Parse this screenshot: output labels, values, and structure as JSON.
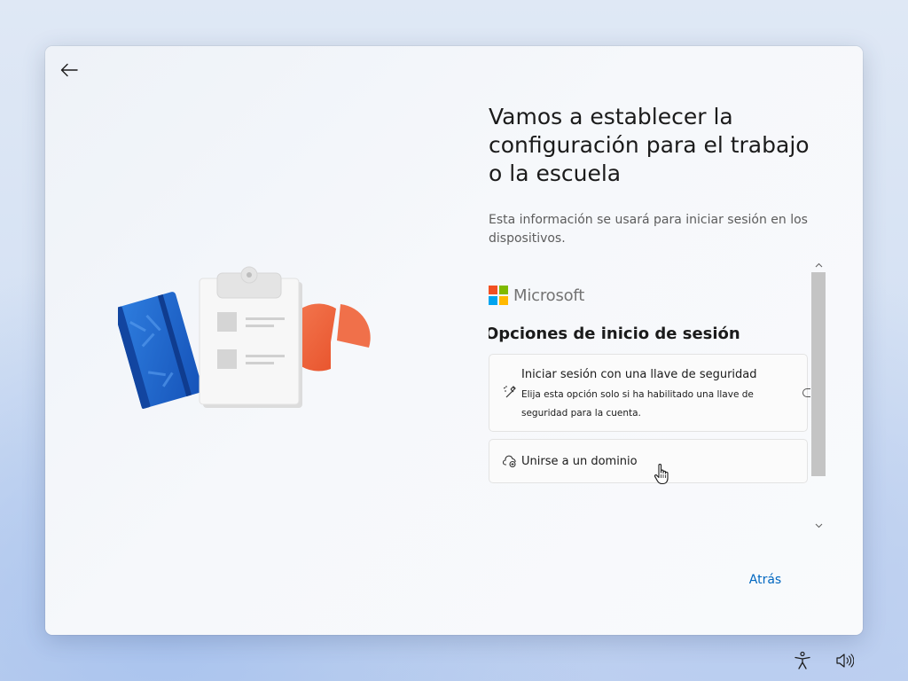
{
  "window": {
    "heading": "Vamos a establecer la configuración para el trabajo o la escuela",
    "subtext": "Esta información se usará para iniciar sesión en los dispositivos."
  },
  "brand": {
    "name": "Microsoft",
    "colors": {
      "red": "#f25022",
      "green": "#7fba00",
      "blue": "#00a4ef",
      "yellow": "#ffb900"
    }
  },
  "signin": {
    "section_title": "Opciones de inicio de sesión",
    "options": [
      {
        "icon": "security-key-icon",
        "title": "Iniciar sesión con una llave de seguridad",
        "description": "Elija esta opción solo si ha habilitado una llave de seguridad para la cuenta."
      },
      {
        "icon": "domain-join-icon",
        "title": "Unirse a un dominio"
      }
    ]
  },
  "footer": {
    "back_label": "Atrás"
  },
  "tray": {
    "icons": [
      "accessibility-icon",
      "volume-icon"
    ]
  },
  "colors": {
    "accent": "#0067c0"
  }
}
